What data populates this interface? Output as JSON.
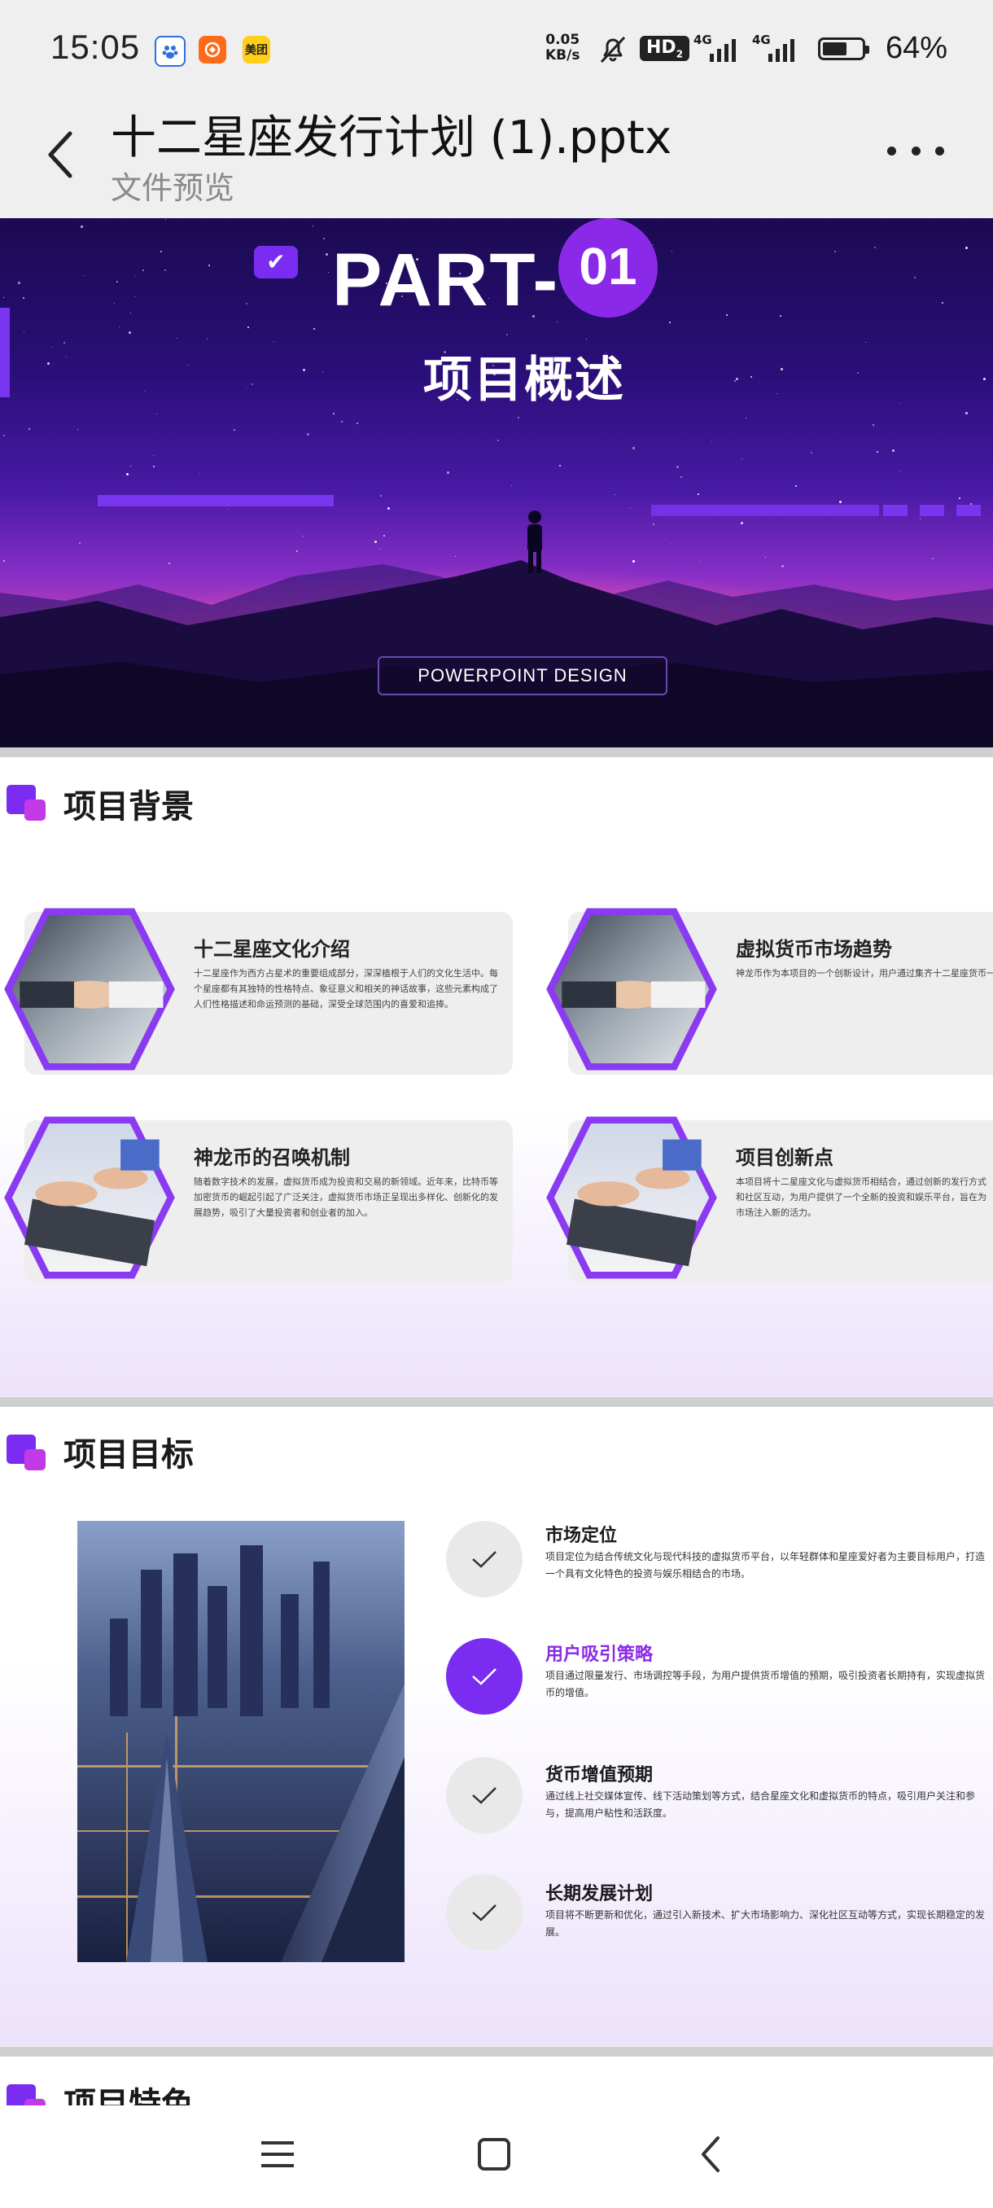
{
  "status_bar": {
    "time": "15:05",
    "app_icons": [
      "baidu-icon",
      "taobao-icon",
      "meituan-icon"
    ],
    "meituan_label": "美团",
    "net_speed_value": "0.05",
    "net_speed_unit": "KB/s",
    "hd_badge": "HD",
    "hd_sub": "2",
    "signal_1": "4G",
    "signal_2": "4G",
    "battery_level": 0.64,
    "battery_percent": "64%"
  },
  "header": {
    "title": "十二星座发行计划 (1).pptx",
    "subtitle": "文件预览"
  },
  "slide1": {
    "part_label": "PART-",
    "part_number": "01",
    "heading": "项目概述",
    "design_label": "POWERPOINT DESIGN"
  },
  "slide2": {
    "section_title": "项目背景",
    "cards": [
      {
        "title": "十二星座文化介绍",
        "text": "十二星座作为西方占星术的重要组成部分，深深植根于人们的文化生活中。每个星座都有其独特的性格特点、象征意义和相关的神话故事，这些元素构成了人们性格描述和命运预测的基础，深受全球范围内的喜爱和追捧。"
      },
      {
        "title": "虚拟货币市场趋势",
        "text": "神龙币作为本项目的一个创新设计，用户通过集齐十二星座货币一枚神龙币，这种机制不仅增加了用户收集星座货币的动力，也为市场增添了趣味性和互动性。"
      },
      {
        "title": "神龙币的召唤机制",
        "text": "随着数字技术的发展，虚拟货币成为投资和交易的新领域。近年来，比特币等加密货币的崛起引起了广泛关注，虚拟货币市场正呈现出多样化、创新化的发展趋势，吸引了大量投资者和创业者的加入。"
      },
      {
        "title": "项目创新点",
        "text": "本项目将十二星座文化与虚拟货币相结合，通过创新的发行方式和社区互动，为用户提供了一个全新的投资和娱乐平台，旨在为市场注入新的活力。"
      }
    ]
  },
  "slide3": {
    "section_title": "项目目标",
    "goals": [
      {
        "title": "市场定位",
        "text": "项目定位为结合传统文化与现代科技的虚拟货币平台，以年轻群体和星座爱好者为主要目标用户，打造一个具有文化特色的投资与娱乐相结合的市场。",
        "active": false
      },
      {
        "title": "用户吸引策略",
        "text": "项目通过限量发行、市场调控等手段，为用户提供货币增值的预期，吸引投资者长期持有，实现虚拟货币的增值。",
        "active": true
      },
      {
        "title": "货币增值预期",
        "text": "通过线上社交媒体宣传、线下活动策划等方式，结合星座文化和虚拟货币的特点，吸引用户关注和参与，提高用户粘性和活跃度。",
        "active": false
      },
      {
        "title": "长期发展计划",
        "text": "项目将不断更新和优化，通过引入新技术、扩大市场影响力、深化社区互动等方式，实现长期稳定的发展。",
        "active": false
      }
    ]
  },
  "slide4": {
    "section_title": "项目特色"
  },
  "nav_bar": {
    "buttons": [
      "menu-icon",
      "home-icon",
      "back-icon"
    ]
  },
  "colors": {
    "accent": "#7a2cf0",
    "accent_secondary": "#c23ae8",
    "background": "#efefef"
  }
}
